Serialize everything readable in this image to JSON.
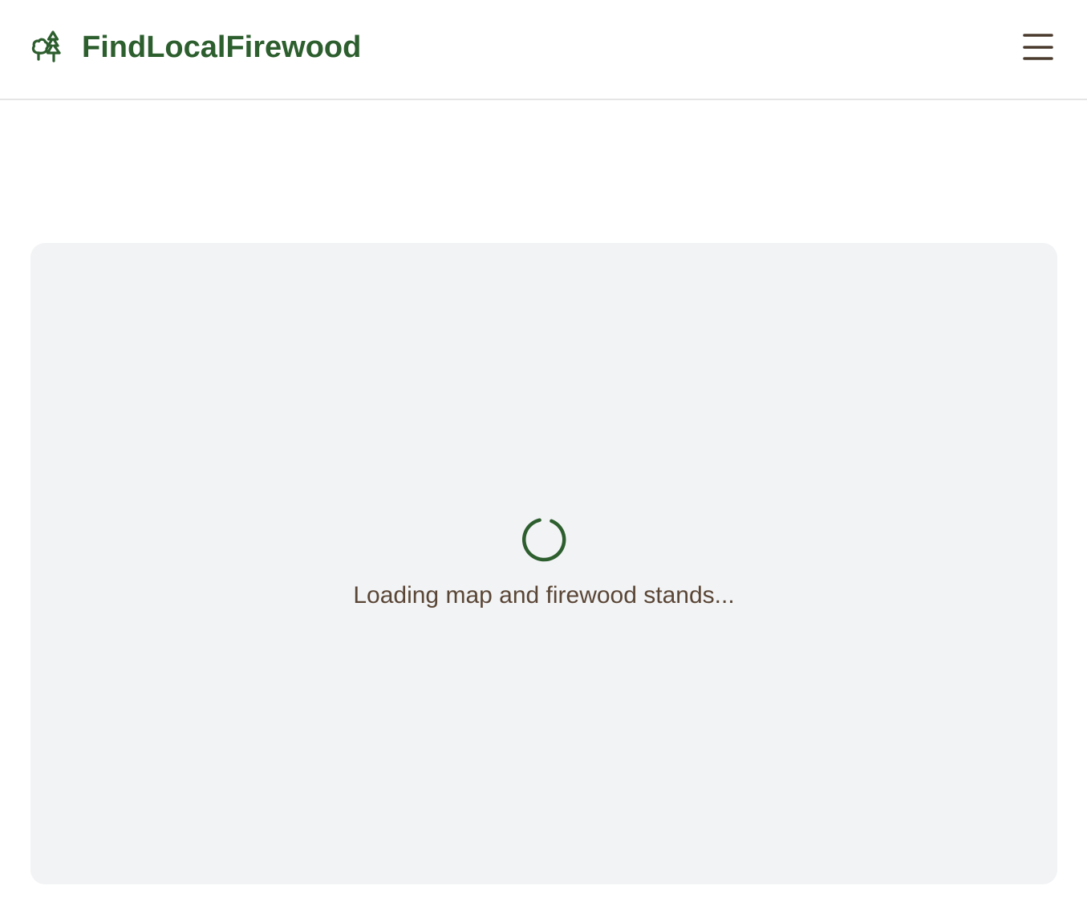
{
  "header": {
    "brand_name": "FindLocalFirewood",
    "logo_icon": "trees-icon",
    "menu_icon": "hamburger-menu-icon"
  },
  "map": {
    "loading_message": "Loading map and firewood stands...",
    "spinner_icon": "loading-spinner-icon"
  },
  "colors": {
    "brand_green": "#2d5e2e",
    "text_brown": "#5a4636",
    "menu_icon": "#4a3b2e",
    "panel_background": "#f2f3f5",
    "header_border": "#e5e5e5"
  }
}
